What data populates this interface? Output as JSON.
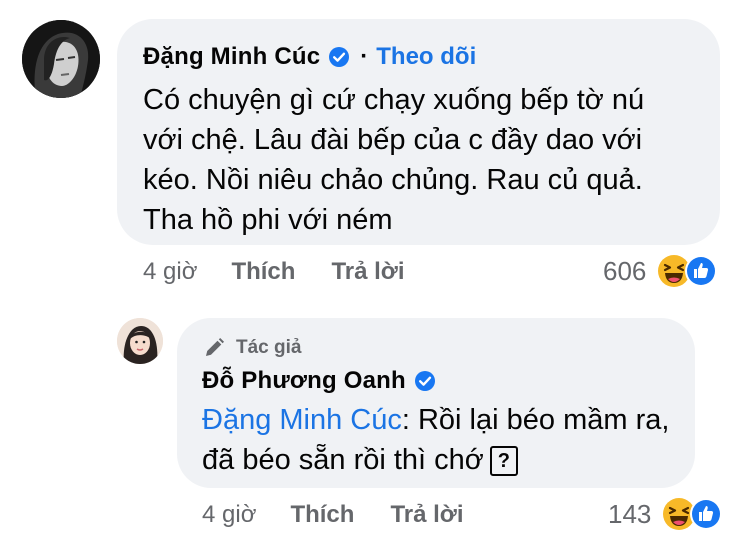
{
  "comment": {
    "author": "Đặng Minh Cúc",
    "follow_label": "Theo dõi",
    "separator": "·",
    "text": "Có chuyện gì cứ chạy xuống bếp tờ nú\nvới chệ. Lâu đài bếp của c đầy dao với\nkéo. Nồi niêu chảo chủng. Rau củ quả.\nTha hồ phi với ném",
    "time": "4 giờ",
    "like_label": "Thích",
    "reply_label": "Trả lời",
    "reaction_count": "606",
    "reactions": [
      "haha-icon",
      "like-icon"
    ]
  },
  "reply": {
    "author_badge": "Tác giả",
    "author": "Đỗ Phương Oanh",
    "mention": "Đặng Minh Cúc",
    "text_after_mention": ": Rồi lại béo mầm ra, đã béo sẵn rồi thì chớ",
    "unknown_glyph": "?",
    "time": "4 giờ",
    "like_label": "Thích",
    "reply_label": "Trả lời",
    "reaction_count": "143",
    "reactions": [
      "haha-icon",
      "like-icon"
    ]
  },
  "colors": {
    "bubble": "#f0f2f5",
    "link_blue": "#1b74e4",
    "meta_gray": "#65676b",
    "verified_blue": "#1877f2",
    "haha_yellow": "#f7b928"
  }
}
